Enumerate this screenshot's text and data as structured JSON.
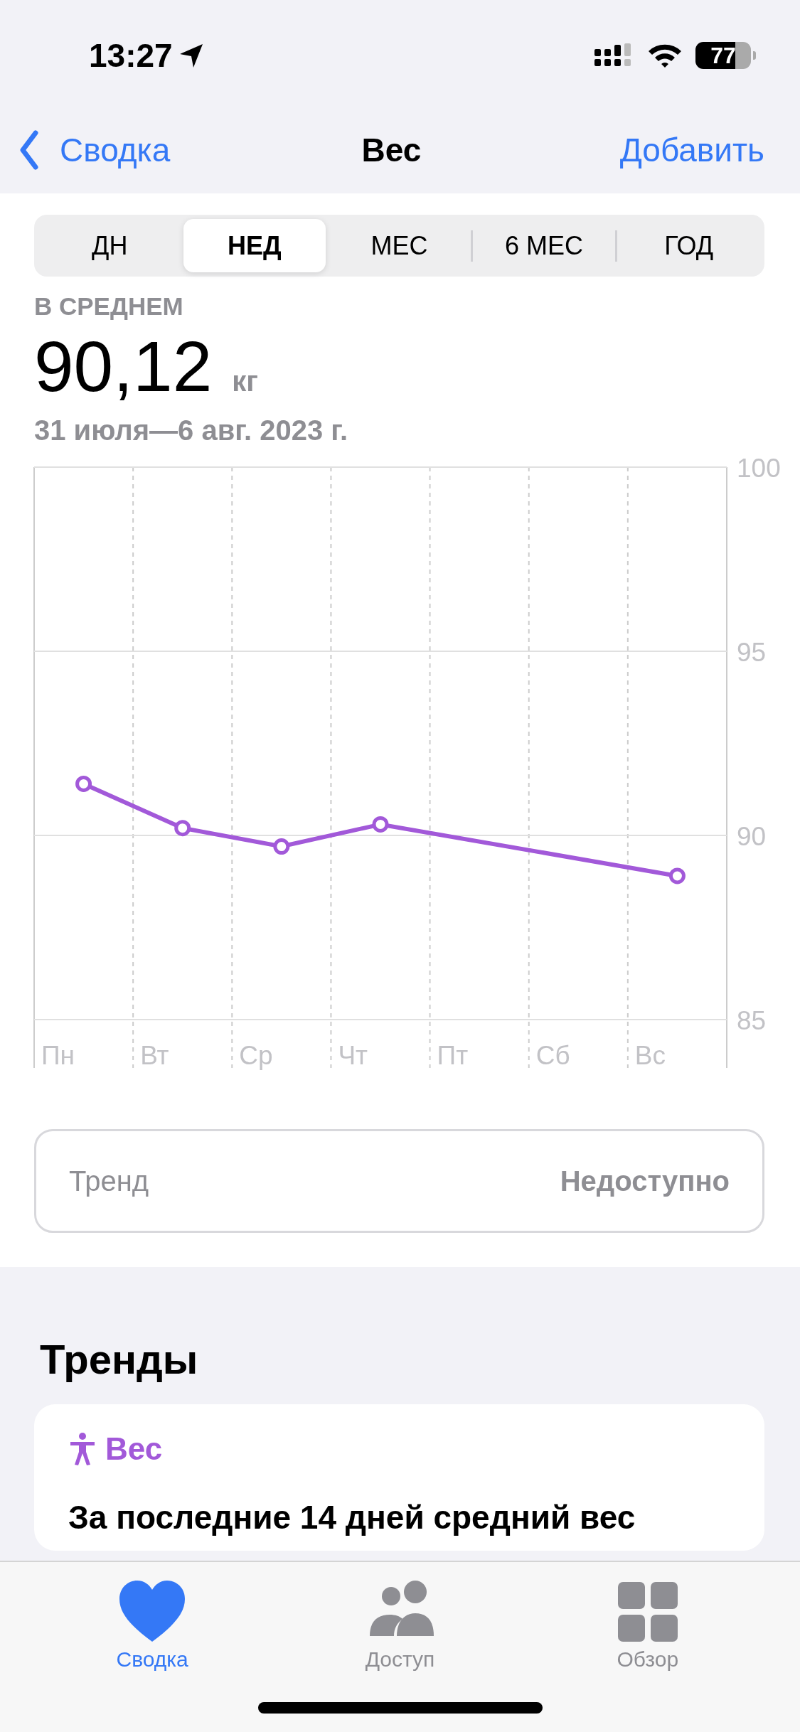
{
  "status_bar": {
    "time": "13:27",
    "battery": "77"
  },
  "nav": {
    "back": "Сводка",
    "title": "Вес",
    "action": "Добавить"
  },
  "segments": [
    {
      "label": "ДН",
      "selected": false
    },
    {
      "label": "НЕД",
      "selected": true
    },
    {
      "label": "МЕС",
      "selected": false
    },
    {
      "label": "6 МЕС",
      "selected": false
    },
    {
      "label": "ГОД",
      "selected": false
    }
  ],
  "summary": {
    "label": "В СРЕДНЕМ",
    "value": "90,12",
    "unit": "кг",
    "range": "31 июля—6 авг. 2023 г."
  },
  "chart_data": {
    "type": "line",
    "categories": [
      "Пн",
      "Вт",
      "Ср",
      "Чт",
      "Пт",
      "Сб",
      "Вс"
    ],
    "ylim": [
      85,
      100
    ],
    "yticks": [
      85,
      90,
      95,
      100
    ],
    "series": [
      {
        "color": "#a259d9",
        "marker": "circle",
        "values": [
          91.4,
          90.2,
          89.7,
          90.3,
          null,
          null,
          88.9
        ]
      }
    ]
  },
  "trend_row": {
    "label": "Тренд",
    "value": "Недоступно"
  },
  "trends": {
    "heading": "Тренды",
    "card": {
      "category": "Вес",
      "text": "За последние 14 дней средний вес"
    }
  },
  "tab_bar": [
    {
      "label": "Сводка",
      "selected": true,
      "kind": "heart"
    },
    {
      "label": "Доступ",
      "selected": false,
      "kind": "people"
    },
    {
      "label": "Обзор",
      "selected": false,
      "kind": "grid"
    }
  ]
}
